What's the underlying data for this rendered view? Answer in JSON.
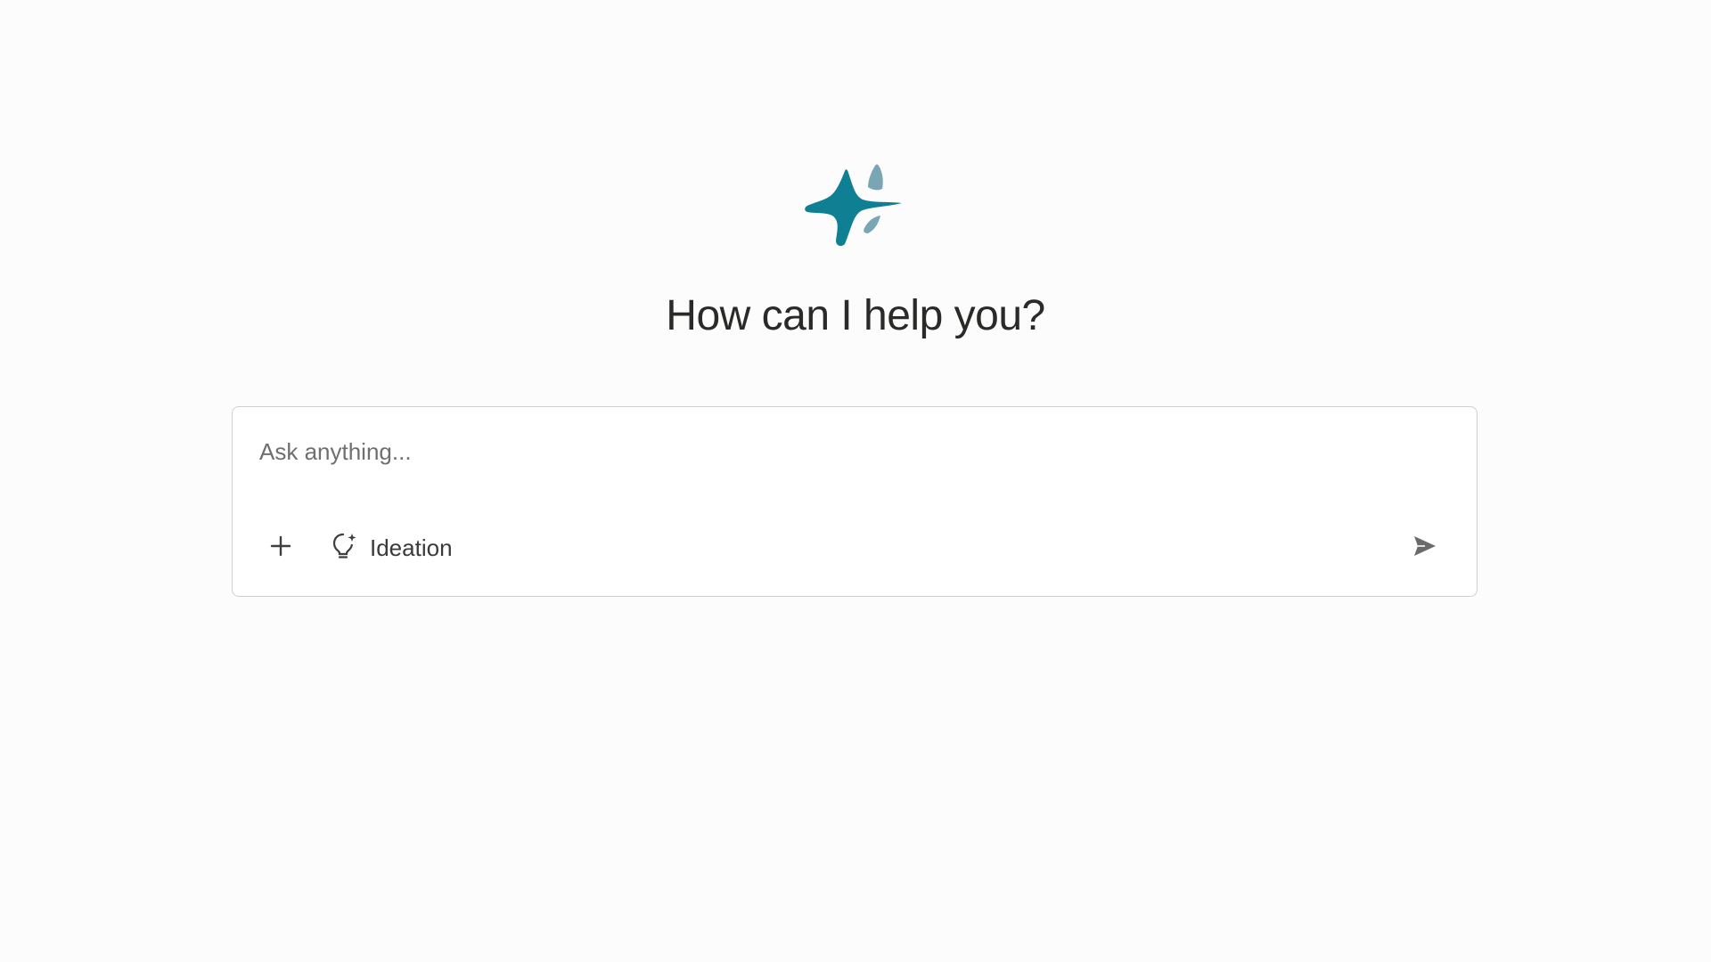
{
  "header": {
    "title": "How can I help you?"
  },
  "composer": {
    "placeholder": "Ask anything...",
    "value": "",
    "mode_label": "Ideation"
  },
  "icons": {
    "logo": "sparkle-logo",
    "add": "plus-icon",
    "mode": "lightbulb-sparkle-icon",
    "send": "send-icon"
  },
  "colors": {
    "brand_primary": "#0f7f93",
    "brand_secondary": "#7aa6b4",
    "background": "#fcfcfc",
    "border": "#cfcfcf",
    "heading_text": "#2a2a28",
    "icon": "#4a4a4a"
  }
}
